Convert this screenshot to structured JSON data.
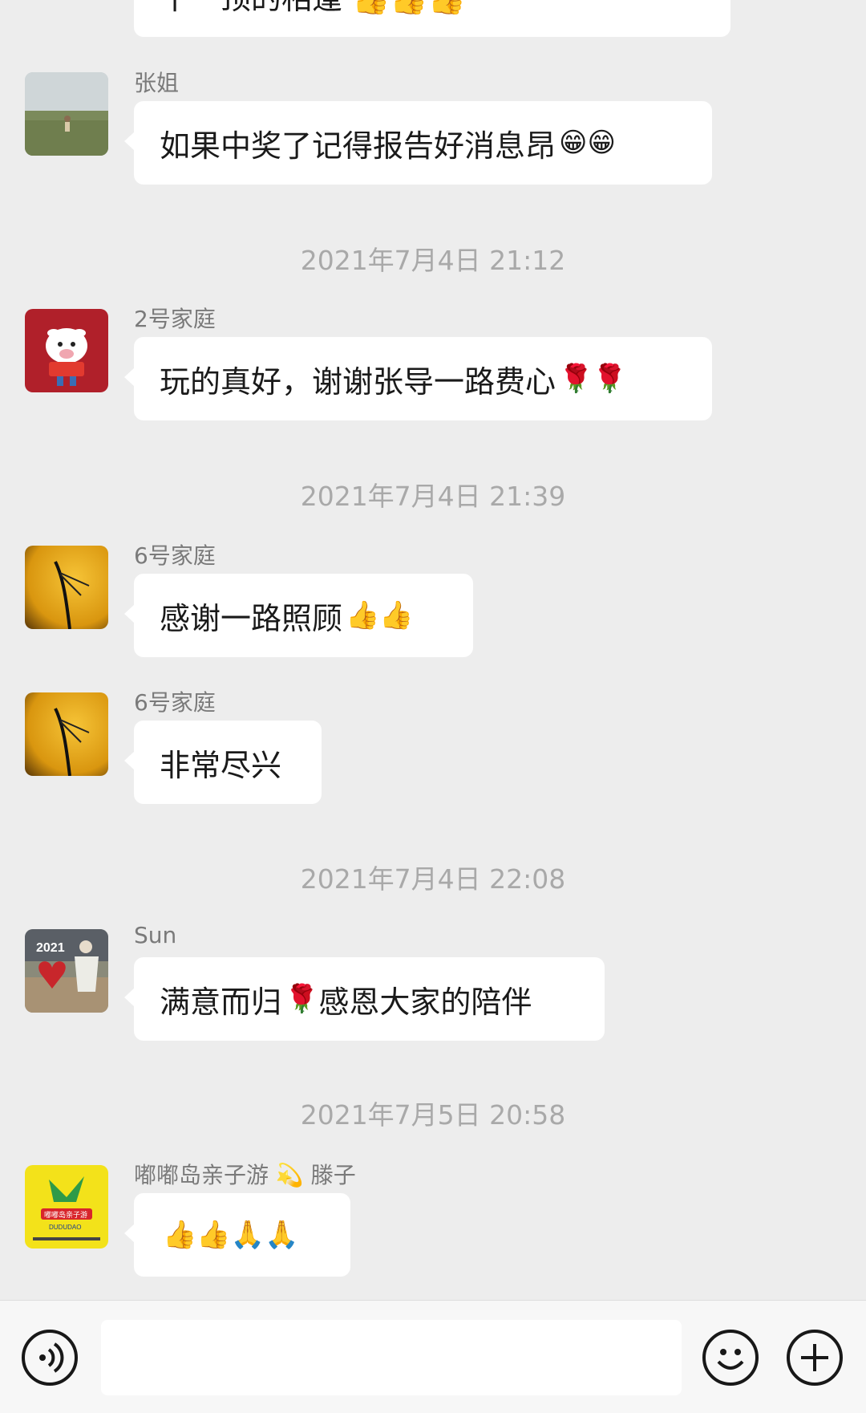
{
  "chat": {
    "partial_top_message": "十一顶的相逢 👍👍👍",
    "messages": [
      {
        "sender": "张姐",
        "text": "如果中奖了记得报告好消息昂",
        "emoji": "😁😁"
      },
      {
        "timestamp": "2021年7月4日 21:12"
      },
      {
        "sender": "2号家庭",
        "text": "玩的真好，谢谢张导一路费心",
        "emoji": "🌹🌹"
      },
      {
        "timestamp": "2021年7月4日 21:39"
      },
      {
        "sender": "6号家庭",
        "text": "感谢一路照顾",
        "emoji": "👍👍"
      },
      {
        "sender": "6号家庭",
        "text": "非常尽兴"
      },
      {
        "timestamp": "2021年7月4日 22:08"
      },
      {
        "sender": "Sun",
        "text_a": "满意而归",
        "emoji": "🌹",
        "text_b": "感恩大家的陪伴"
      },
      {
        "timestamp": "2021年7月5日 20:58"
      },
      {
        "sender_a": "嘟嘟岛亲子游",
        "sender_emoji": "💫",
        "sender_b": "滕子",
        "emoji": "👍👍🙏🙏"
      }
    ],
    "avatars": {
      "avatar_2": {
        "text": "2021"
      },
      "avatar_3": {
        "title": "嘟嘟岛亲子游",
        "subtitle": "DUDUDAO"
      }
    }
  },
  "input_bar": {
    "voice_icon": "voice-icon",
    "emoji_icon": "emoji-icon",
    "plus_icon": "plus-icon"
  },
  "colors": {
    "background": "#ededed",
    "bubble": "#ffffff",
    "timestamp": "#a9a9a9"
  }
}
